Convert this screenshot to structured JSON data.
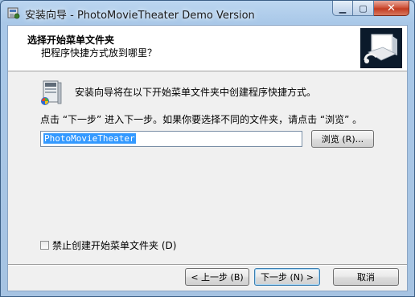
{
  "window": {
    "title": "安装向导 - PhotoMovieTheater Demo Version",
    "minimize_glyph": "▁",
    "maximize_glyph": "▢",
    "close_glyph": "✕"
  },
  "header": {
    "title": "选择开始菜单文件夹",
    "subtitle": "把程序快捷方式放到哪里？"
  },
  "body": {
    "intro_text": "安装向导将在以下开始菜单文件夹中创建程序快捷方式。",
    "instruction_text": "点击 “下一步” 进入下一步。如果你要选择不同的文件夹，请点击 “浏览” 。",
    "folder_value": "PhotoMovieTheater",
    "browse_label": "浏览 (R)...",
    "no_folder_checkbox_label": "禁止创建开始菜单文件夹 (D)",
    "no_folder_checked": false
  },
  "footer": {
    "back_label": "< 上一步 (B)",
    "next_label": "下一步 (N) >",
    "cancel_label": "取消"
  },
  "icons": {
    "app": "installer-icon",
    "folder": "start-menu-folder-icon",
    "logo": "photomovietheater-logo"
  },
  "colors": {
    "title_bar": "#a9c8e8",
    "selection": "#3399ff",
    "close_button": "#c23c22"
  }
}
